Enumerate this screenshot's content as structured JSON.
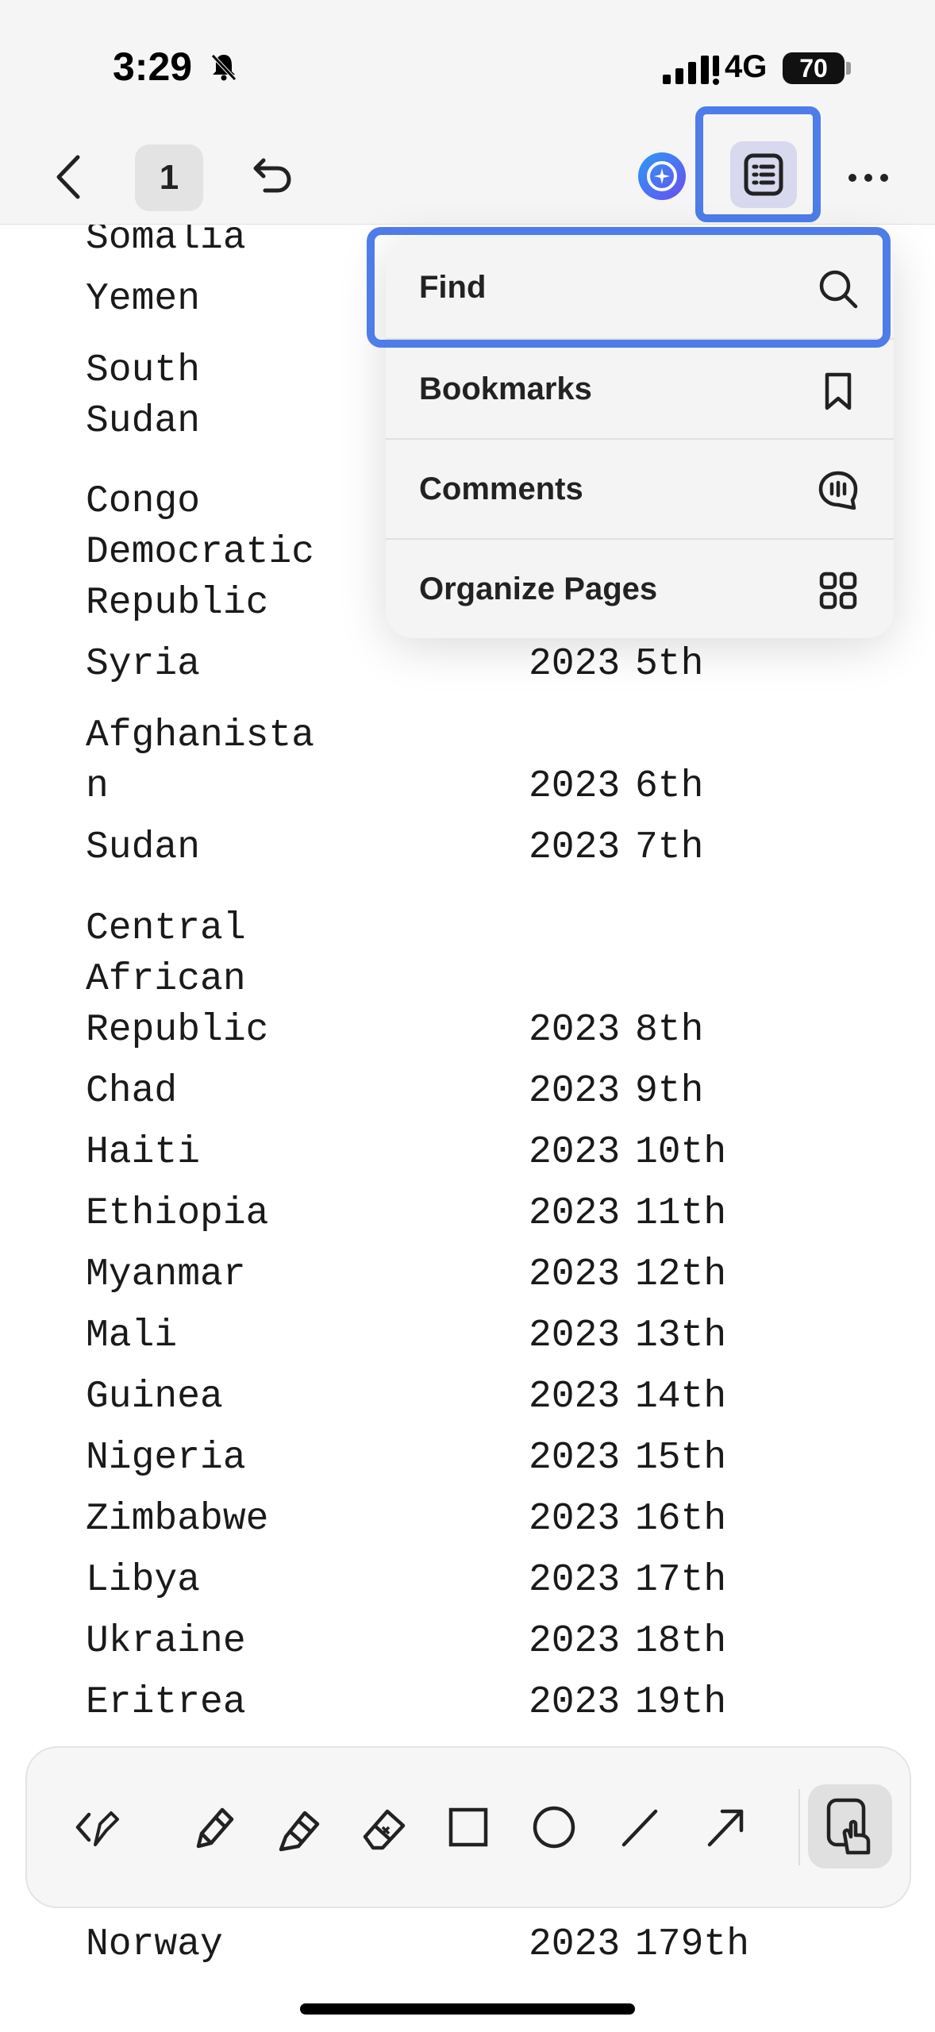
{
  "status_bar": {
    "time": "3:29",
    "network": "4G",
    "battery": "70"
  },
  "toolbar_top": {
    "page_number": "1"
  },
  "document": {
    "rows": [
      {
        "country": "Somalia",
        "year": "",
        "rank": ""
      },
      {
        "country": "Yemen",
        "year": "",
        "rank": ""
      },
      {
        "country": "South",
        "year": "",
        "rank": ""
      },
      {
        "country": "Sudan",
        "year": "",
        "rank": ""
      },
      {
        "country": "Congo",
        "year": "",
        "rank": ""
      },
      {
        "country": "Democratic",
        "year": "",
        "rank": ""
      },
      {
        "country": "Republic",
        "year": "",
        "rank": ""
      },
      {
        "country": "Syria",
        "year": "2023",
        "rank": "5th"
      },
      {
        "country": "Afghanista",
        "year": "",
        "rank": ""
      },
      {
        "country": "n",
        "year": "2023",
        "rank": "6th"
      },
      {
        "country": "Sudan",
        "year": "2023",
        "rank": "7th"
      },
      {
        "country": "Central",
        "year": "",
        "rank": ""
      },
      {
        "country": "African",
        "year": "",
        "rank": ""
      },
      {
        "country": "Republic",
        "year": "2023",
        "rank": "8th"
      },
      {
        "country": "Chad",
        "year": "2023",
        "rank": "9th"
      },
      {
        "country": "Haiti",
        "year": "2023",
        "rank": "10th"
      },
      {
        "country": "Ethiopia",
        "year": "2023",
        "rank": "11th"
      },
      {
        "country": "Myanmar",
        "year": "2023",
        "rank": "12th"
      },
      {
        "country": "Mali",
        "year": "2023",
        "rank": "13th"
      },
      {
        "country": "Guinea",
        "year": "2023",
        "rank": "14th"
      },
      {
        "country": "Nigeria",
        "year": "2023",
        "rank": "15th"
      },
      {
        "country": "Zimbabwe",
        "year": "2023",
        "rank": "16th"
      },
      {
        "country": "Libya",
        "year": "2023",
        "rank": "17th"
      },
      {
        "country": "Ukraine",
        "year": "2023",
        "rank": "18th"
      },
      {
        "country": "Eritrea",
        "year": "2023",
        "rank": "19th"
      },
      {
        "country": "Norway",
        "year": "2023",
        "rank": "179th"
      }
    ]
  },
  "menu": {
    "items": [
      {
        "label": "Find",
        "icon": "search-icon"
      },
      {
        "label": "Bookmarks",
        "icon": "bookmark-icon"
      },
      {
        "label": "Comments",
        "icon": "comment-icon"
      },
      {
        "label": "Organize Pages",
        "icon": "grid-icon"
      }
    ]
  },
  "annotation_tools": [
    "back-chevron-icon",
    "pencil-icon",
    "marker-icon",
    "highlighter-icon",
    "eraser-icon",
    "rectangle-icon",
    "circle-icon",
    "line-icon",
    "arrow-icon",
    "touch-mode-icon"
  ],
  "colors": {
    "highlight": "#4e7de9",
    "menu_bg": "#f4f4f4",
    "toolbar_bg": "#f6f6f6"
  }
}
